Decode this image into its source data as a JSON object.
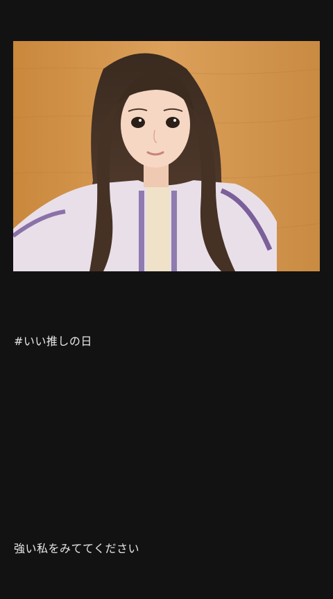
{
  "post": {
    "photo_alt": "selfie photo",
    "hashtag": "#いい推しの日",
    "message": "強い私をみててください"
  },
  "colors": {
    "background": "#121212",
    "text": "#e8e8e8",
    "wall": "#d1924a"
  }
}
